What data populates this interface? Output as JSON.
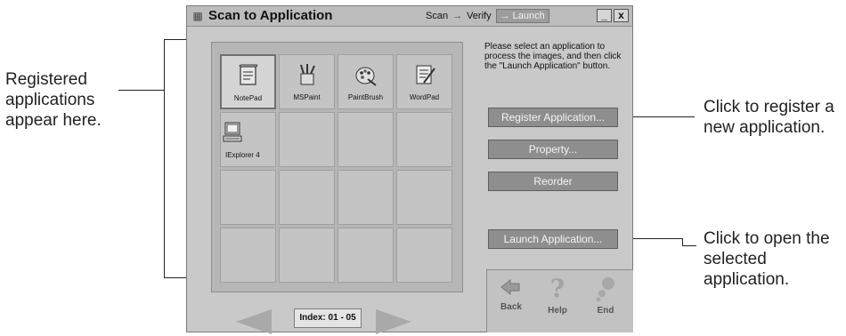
{
  "window": {
    "title": "Scan to Application",
    "steps": [
      "Scan",
      "Verify",
      "Launch"
    ],
    "active_step": "Launch",
    "controls": {
      "minimize": "_",
      "close": "x"
    }
  },
  "apps": [
    {
      "label": "NotePad",
      "icon": "notepad-icon",
      "selected": true
    },
    {
      "label": "MSPaint",
      "icon": "mspaint-icon"
    },
    {
      "label": "PaintBrush",
      "icon": "paintbrush-icon"
    },
    {
      "label": "WordPad",
      "icon": "wordpad-icon"
    },
    {
      "label": "IExplorer 4",
      "icon": "iexplorer-icon"
    }
  ],
  "index_label": "Index: 01 - 05",
  "instructions": "Please select an application to process the images, and then click the \"Launch Application\" button.",
  "buttons": {
    "register": "Register Application...",
    "property": "Property...",
    "reorder": "Reorder",
    "launch": "Launch Application..."
  },
  "footer": {
    "back": "Back",
    "help": "Help",
    "end": "End"
  },
  "callouts": {
    "left": [
      "Registered",
      "applications",
      "appear here."
    ],
    "register": [
      "Click to register a",
      "new application."
    ],
    "launch": [
      "Click to open the",
      "selected",
      "application."
    ]
  }
}
